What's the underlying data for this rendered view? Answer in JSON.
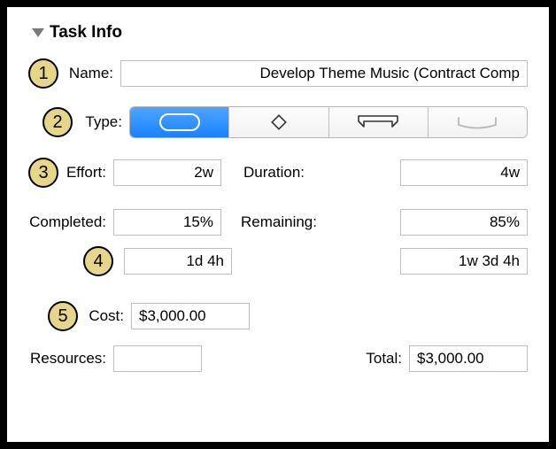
{
  "header": {
    "title": "Task Info"
  },
  "badges": {
    "b1": "1",
    "b2": "2",
    "b3": "3",
    "b4": "4",
    "b5": "5"
  },
  "labels": {
    "name": "Name:",
    "type": "Type:",
    "effort": "Effort:",
    "duration": "Duration:",
    "completed": "Completed:",
    "remaining": "Remaining:",
    "cost": "Cost:",
    "resources": "Resources:",
    "total": "Total:"
  },
  "values": {
    "name": "Develop Theme Music (Contract Comp",
    "effort": "2w",
    "duration": "4w",
    "completed": "15%",
    "remaining": "85%",
    "completed_time": "1d 4h",
    "remaining_time": "1w 3d 4h",
    "cost": "$3,000.00",
    "resources": "",
    "total": "$3,000.00"
  },
  "type_options": {
    "selected": 0,
    "icons": [
      "task-bar-icon",
      "milestone-diamond-icon",
      "group-bracket-icon",
      "hammock-icon"
    ]
  }
}
